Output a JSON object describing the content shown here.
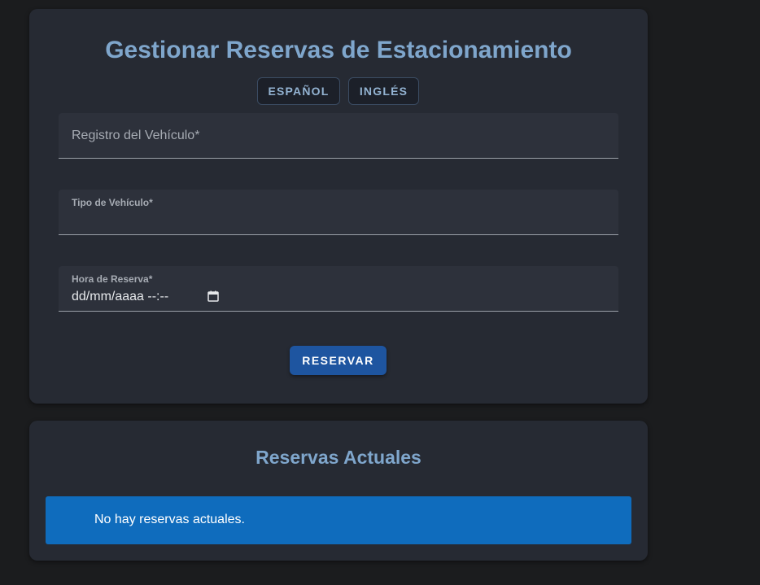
{
  "booking": {
    "title": "Gestionar Reservas de Estacionamiento",
    "language_buttons": [
      "ESPAÑOL",
      "INGLÉS"
    ],
    "fields": {
      "registration": {
        "placeholder": "Registro del Vehículo*"
      },
      "vehicle_type": {
        "label": "Tipo de Vehículo*",
        "value": ""
      },
      "booking_time": {
        "label": "Hora de Reserva*",
        "value": "dd/mm/aaaa --:--",
        "icon": "calendar-icon"
      }
    },
    "submit_label": "RESERVAR"
  },
  "reservations": {
    "title": "Reservas Actuales",
    "empty_message": "No hay reservas actuales."
  },
  "colors": {
    "page_background": "#1b1c1e",
    "card_background": "#262a33",
    "title": "#7fa6cc",
    "primary_button": "#1e55a0",
    "info_alert": "#0f6cbd"
  }
}
